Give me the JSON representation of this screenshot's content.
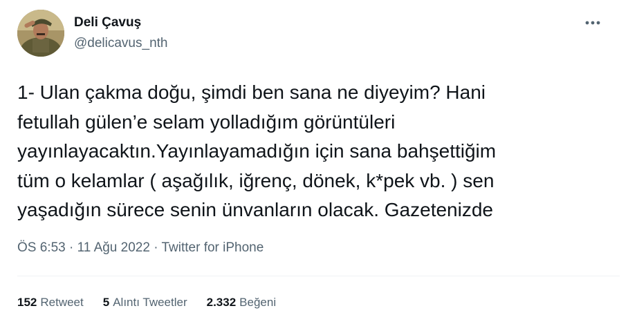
{
  "author": {
    "display_name": "Deli Çavuş",
    "handle": "@delicavus_nth",
    "avatar_icon": "profile-photo-soldier"
  },
  "menu": {
    "more_icon": "more-horizontal-icon"
  },
  "tweet": {
    "text": "1- Ulan çakma doğu, şimdi ben sana ne diyeyim? Hani\nfetullah gülen’e selam yolladığım görüntüleri\nyayınlayacaktın.Yayınlayamadığın için sana bahşettiğim\ntüm o kelamlar ( aşağılık, iğrenç, dönek, k*pek vb. ) sen\nyaşadığın sürece senin ünvanların olacak. Gazetenizde",
    "time": "ÖS 6:53",
    "separator": "·",
    "date": "11 Ağu 2022",
    "source": "Twitter for iPhone"
  },
  "stats": [
    {
      "count": "152",
      "label": "Retweet"
    },
    {
      "count": "5",
      "label": "Alıntı Tweetler"
    },
    {
      "count": "2.332",
      "label": "Beğeni"
    }
  ],
  "colors": {
    "text_primary": "#0f1419",
    "text_secondary": "#536471",
    "divider": "#eff3f4"
  }
}
